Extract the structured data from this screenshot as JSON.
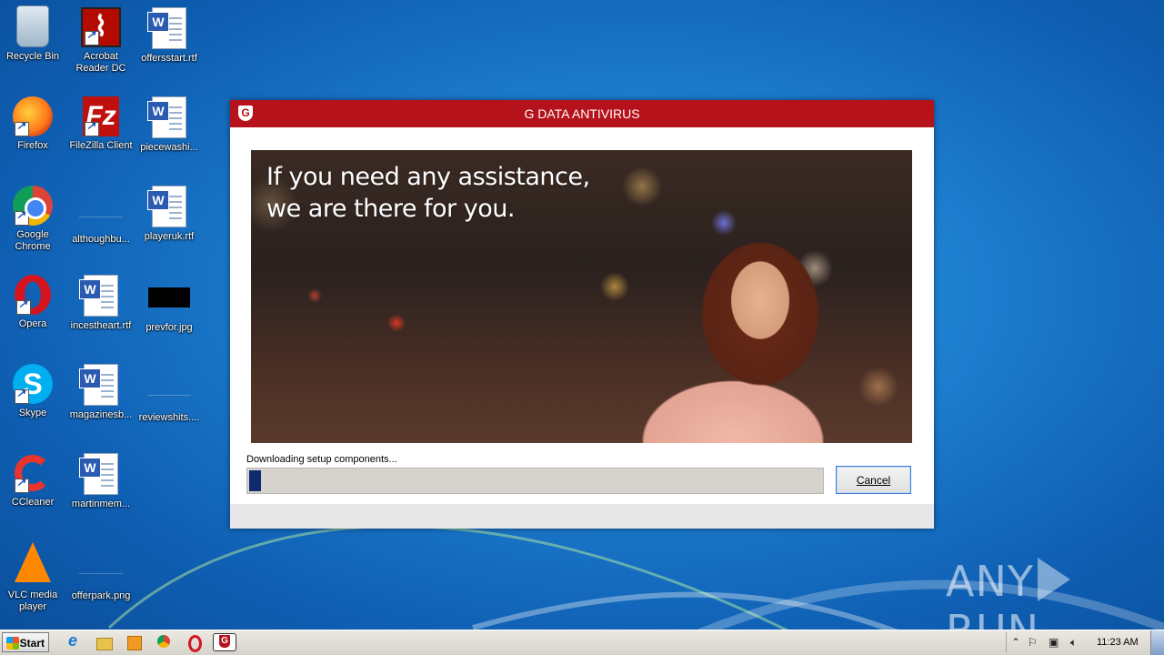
{
  "desktop": {
    "icons": [
      {
        "label": "Recycle Bin"
      },
      {
        "label": "Acrobat Reader DC"
      },
      {
        "label": "offersstart.rtf"
      },
      {
        "label": "Firefox"
      },
      {
        "label": "FileZilla Client"
      },
      {
        "label": "piecewashi..."
      },
      {
        "label": "Google Chrome"
      },
      {
        "label": "althoughbu..."
      },
      {
        "label": "playeruk.rtf"
      },
      {
        "label": "Opera"
      },
      {
        "label": "incestheart.rtf"
      },
      {
        "label": "prevfor.jpg"
      },
      {
        "label": "Skype"
      },
      {
        "label": "magazinesb..."
      },
      {
        "label": "reviewshits...."
      },
      {
        "label": "CCleaner"
      },
      {
        "label": "martinmem..."
      },
      {
        "label": "VLC media player"
      },
      {
        "label": "offerpark.png"
      }
    ]
  },
  "dialog": {
    "title": "G DATA ANTIVIRUS",
    "logo_letter": "G",
    "banner_line1": "If you need any assistance,",
    "banner_line2": "we are there for you.",
    "status_text": "Downloading setup components...",
    "progress_fraction": 0.02,
    "cancel_label": "Cancel"
  },
  "watermark": {
    "left": "ANY",
    "right": "RUN"
  },
  "taskbar": {
    "start_label": "Start",
    "clock": "11:23 AM",
    "pinned": [
      "internet-explorer-icon",
      "folder-icon",
      "media-player-icon",
      "chrome-icon",
      "opera-icon",
      "gdata-icon"
    ]
  },
  "colors": {
    "titlebar": "#b5121b",
    "progress": "#0f2a6e",
    "desktop": "#1e7fd0"
  }
}
